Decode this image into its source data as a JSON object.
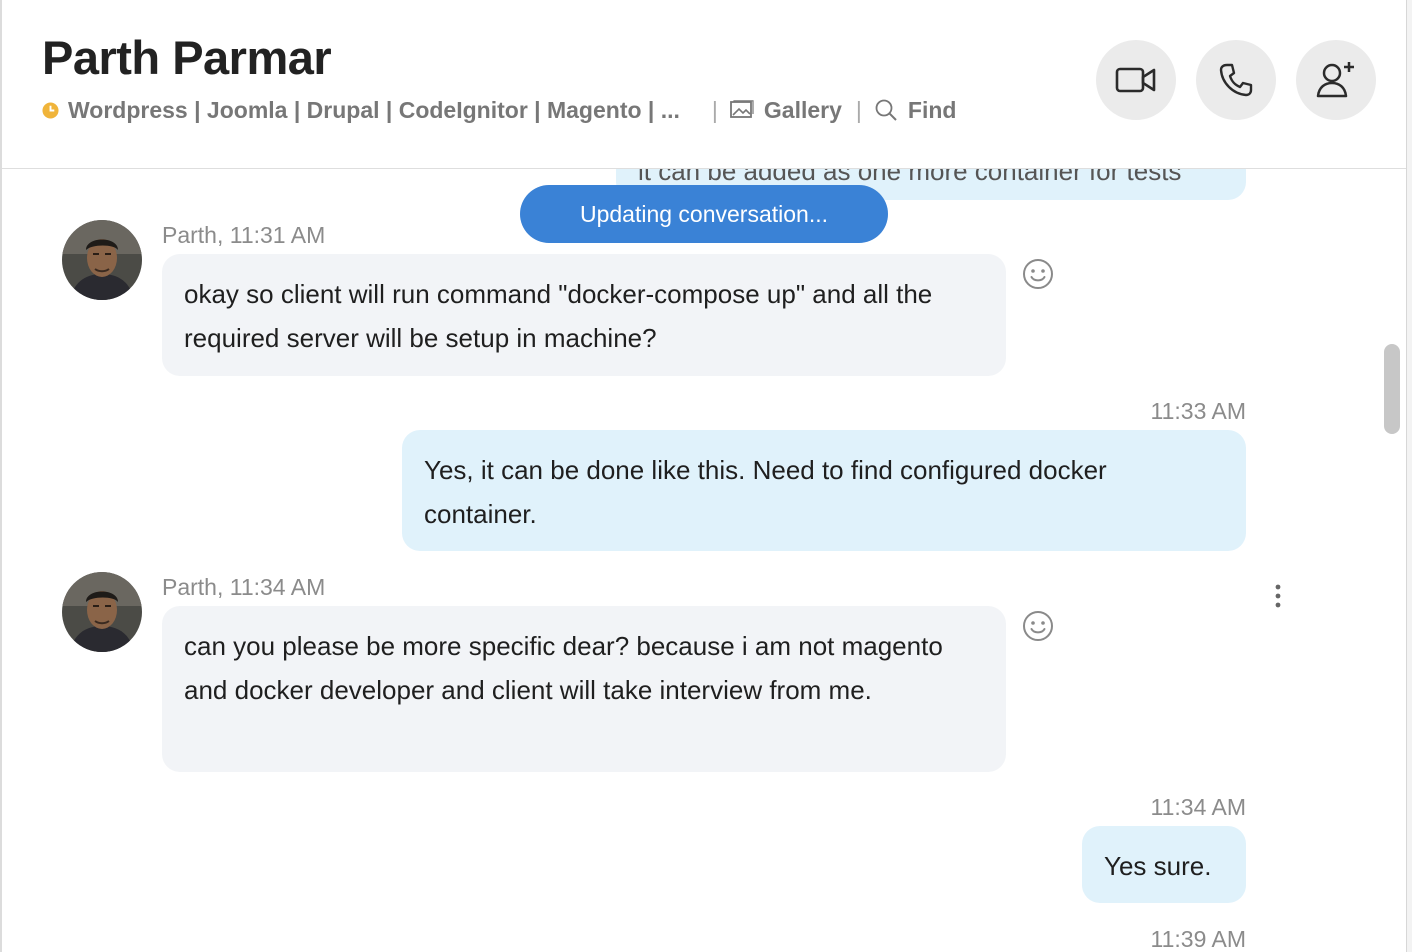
{
  "header": {
    "contact_name": "Parth Parmar",
    "mood_text": "Wordpress | Joomla | Drupal | CodeIgnitor | Magento | ...",
    "separator": "|",
    "gallery_label": "Gallery",
    "find_label": "Find"
  },
  "status": {
    "updating_label": "Updating conversation..."
  },
  "messages": [
    {
      "text": "it can be added as one more container for tests"
    },
    {
      "sender_time": "Parth, 11:31 AM",
      "text": "okay so client will run command \"docker-compose up\" and all the required server will be setup in machine?"
    },
    {
      "time": "11:33 AM",
      "text": "Yes, it can be done like this. Need to find configured docker container."
    },
    {
      "sender_time": "Parth, 11:34 AM",
      "text": "can you please be more specific dear? because i am not magento and docker developer and client will take interview from me."
    },
    {
      "time": "11:34 AM",
      "text": "Yes sure."
    },
    {
      "time": "11:39 AM"
    }
  ],
  "colors": {
    "accent": "#3a82d6",
    "incoming_bubble": "#f2f4f7",
    "outgoing_bubble": "#e0f2fb",
    "mood_icon": "#f0b43a"
  },
  "icons": {
    "video": "video-call-icon",
    "phone": "audio-call-icon",
    "add_person": "add-person-icon",
    "gallery": "gallery-icon",
    "find": "search-icon",
    "react": "smiley-icon",
    "more": "more-options-icon"
  }
}
